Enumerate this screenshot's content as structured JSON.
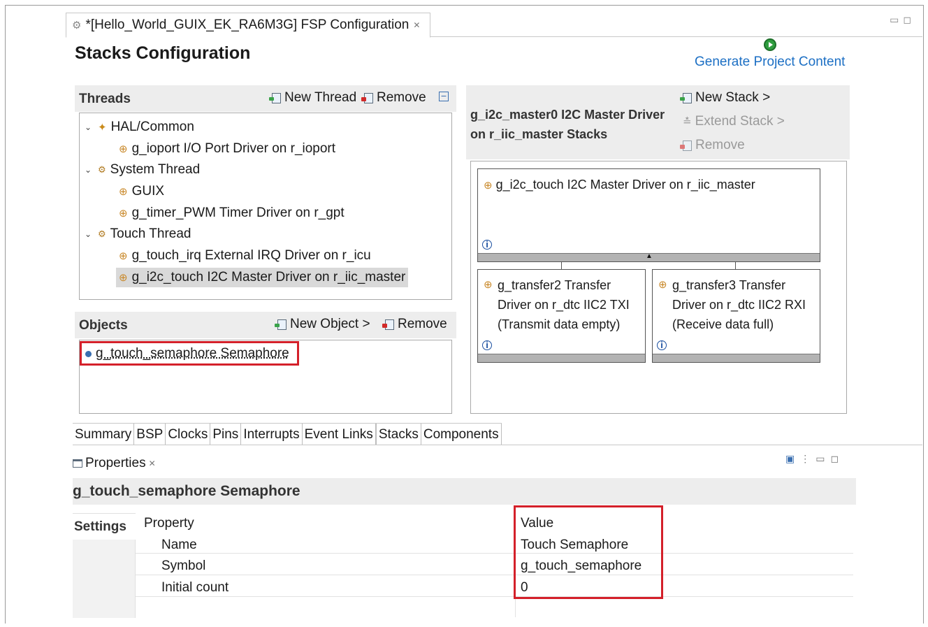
{
  "editor": {
    "tab_title": "*[Hello_World_GUIX_EK_RA6M3G] FSP Configuration",
    "page_title": "Stacks Configuration",
    "generate_label": "Generate Project Content"
  },
  "threads": {
    "header": "Threads",
    "new_thread": "New Thread",
    "remove": "Remove",
    "tree": [
      {
        "label": "HAL/Common",
        "level": 0,
        "expanded": true,
        "icon": "hal-icon"
      },
      {
        "label": "g_ioport I/O Port Driver on r_ioport",
        "level": 1,
        "icon": "component-icon"
      },
      {
        "label": "System Thread",
        "level": 0,
        "expanded": true,
        "icon": "thread-gear-icon"
      },
      {
        "label": "GUIX",
        "level": 1,
        "icon": "component-icon"
      },
      {
        "label": "g_timer_PWM Timer Driver on r_gpt",
        "level": 1,
        "icon": "component-icon"
      },
      {
        "label": "Touch Thread",
        "level": 0,
        "expanded": true,
        "icon": "thread-gear-icon"
      },
      {
        "label": "g_touch_irq External IRQ Driver on r_icu",
        "level": 1,
        "icon": "component-icon"
      },
      {
        "label": "g_i2c_touch I2C Master Driver on r_iic_master",
        "level": 1,
        "icon": "component-icon",
        "selected": true
      }
    ]
  },
  "objects": {
    "header": "Objects",
    "new_object": "New Object >",
    "remove": "Remove",
    "items": [
      "g_touch_semaphore Semaphore"
    ]
  },
  "stacks": {
    "header_line1": "g_i2c_master0 I2C Master Driver",
    "header_line2": "on r_iic_master Stacks",
    "new_stack": "New Stack >",
    "extend_stack": "Extend Stack >",
    "remove": "Remove",
    "top_box": "g_i2c_touch I2C Master Driver on r_iic_master",
    "child_left": [
      "g_transfer2 Transfer",
      "Driver on r_dtc IIC2 TXI",
      "(Transmit data empty)"
    ],
    "child_right": [
      "g_transfer3 Transfer",
      "Driver on r_dtc IIC2 RXI",
      "(Receive data full)"
    ]
  },
  "bottom_tabs": [
    "Summary",
    "BSP",
    "Clocks",
    "Pins",
    "Interrupts",
    "Event Links",
    "Stacks",
    "Components"
  ],
  "active_bottom_tab": "Stacks",
  "properties": {
    "view_title": "Properties",
    "selection_title": "g_touch_semaphore Semaphore",
    "side_tab": "Settings",
    "col_property": "Property",
    "col_value": "Value",
    "rows": [
      {
        "property": "Name",
        "value": "Touch Semaphore"
      },
      {
        "property": "Symbol",
        "value": "g_touch_semaphore"
      },
      {
        "property": "Initial count",
        "value": "0"
      }
    ]
  },
  "colors": {
    "highlight": "#d4202a",
    "link": "#1c6fc4"
  }
}
